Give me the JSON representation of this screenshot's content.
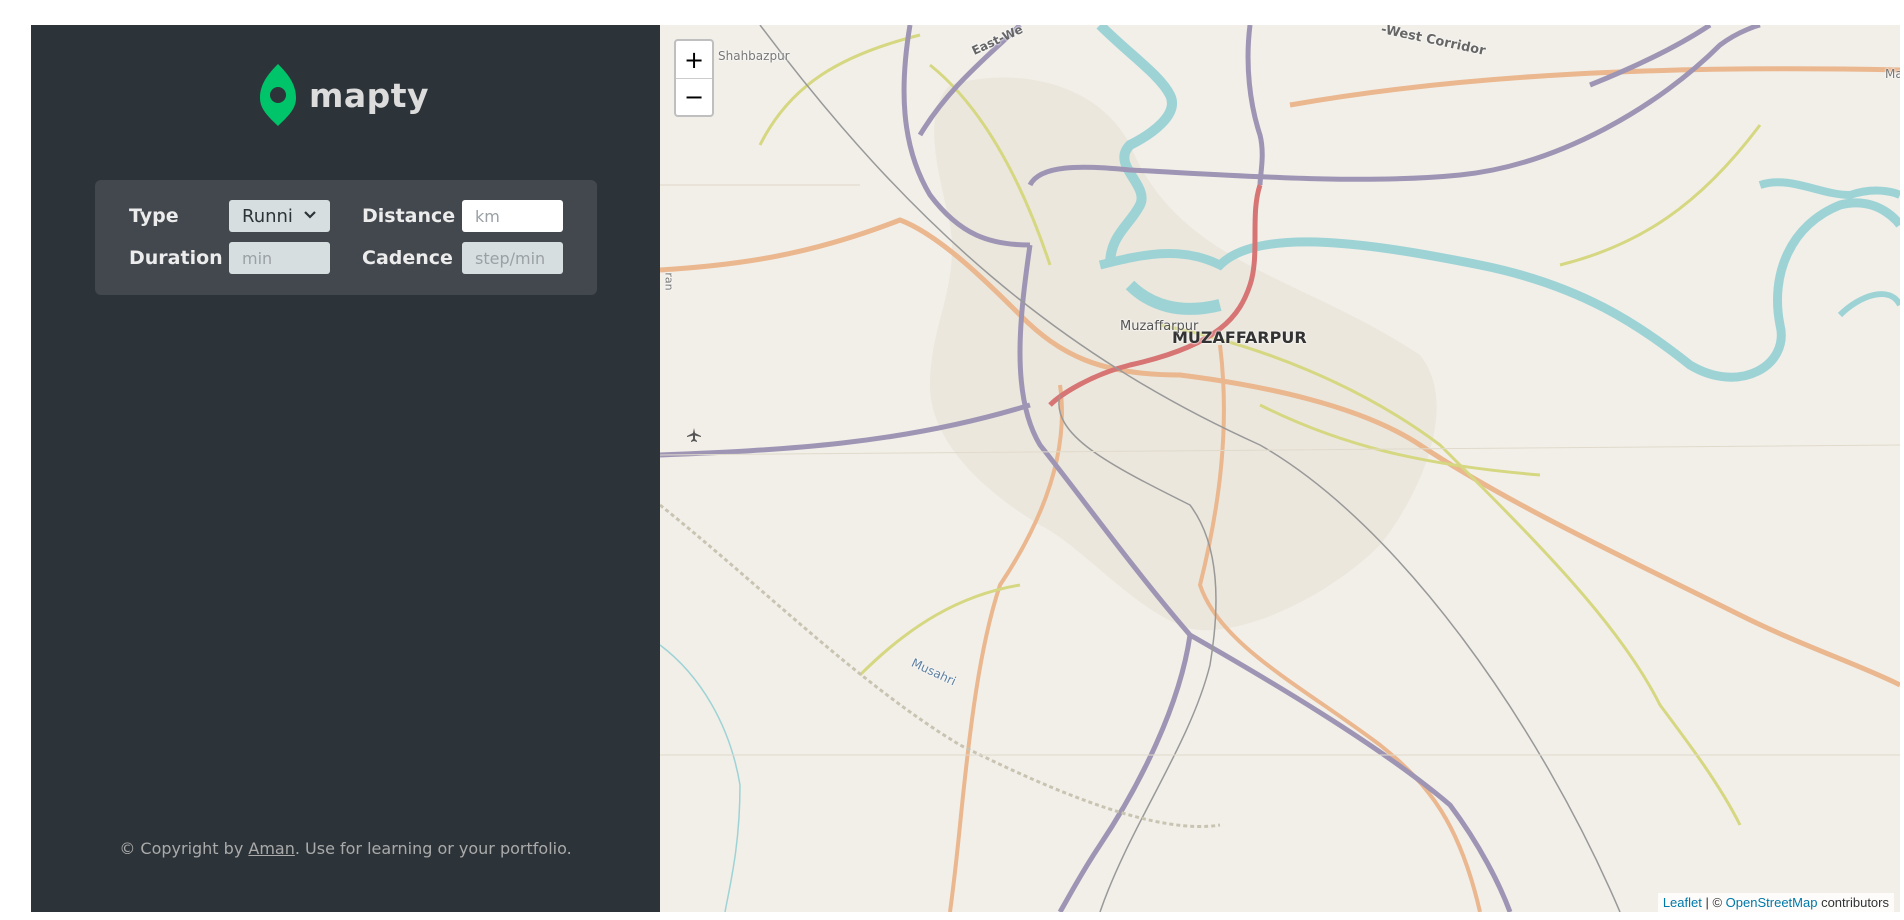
{
  "app": {
    "name": "mapty"
  },
  "form": {
    "type_label": "Type",
    "type_value": "Runni",
    "distance_label": "Distance",
    "distance_placeholder": "km",
    "duration_label": "Duration",
    "duration_placeholder": "min",
    "cadence_label": "Cadence",
    "cadence_placeholder": "step/min"
  },
  "footer": {
    "prefix": "© Copyright by ",
    "author": "Aman",
    "suffix": ". Use for learning or your portfolio."
  },
  "map": {
    "zoom_in": "+",
    "zoom_out": "−",
    "labels": {
      "city_major": "MUZAFFARPUR",
      "city_minor": "Muzaffarpur",
      "town_nw": "Shahbazpur",
      "road_top_left": "East-We",
      "road_top": "-West Corridor",
      "river_sw": "Musahri",
      "edge_right": "Ma",
      "edge_left": "ran"
    },
    "attribution": {
      "leaflet": "Leaflet",
      "sep": " | © ",
      "osm": "OpenStreetMap",
      "contrib": " contributors"
    }
  },
  "colors": {
    "sidebar_bg": "#2d3439",
    "form_bg": "#42484d",
    "brand_green": "#00c46a",
    "map_bg": "#f2efe9",
    "river": "#9ed3d6",
    "motorway": "#9e95b5",
    "primary_road": "#eab78f",
    "secondary_road": "#d6d781",
    "trunk_red": "#d77474"
  },
  "icons": [
    "map-pin-icon",
    "chevron-down-icon",
    "airport-icon"
  ]
}
